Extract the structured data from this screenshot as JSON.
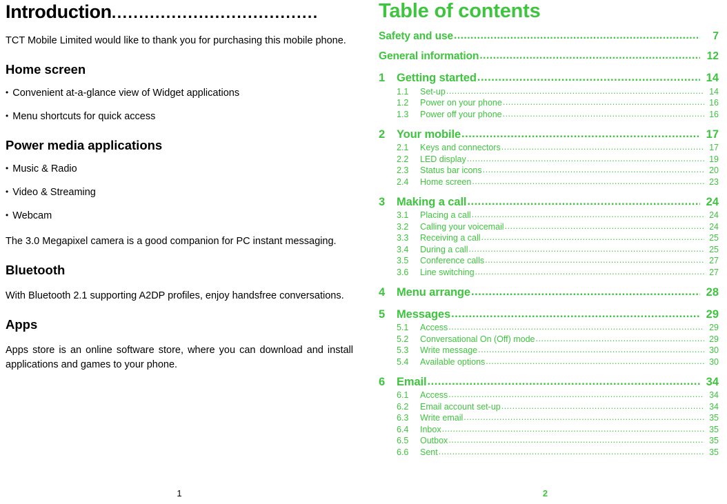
{
  "left": {
    "title": "Introduction",
    "title_dots": "......................................",
    "intro_paragraph": "TCT Mobile Limited would like to thank you for purchasing this mobile phone.",
    "sections": [
      {
        "heading": "Home screen",
        "bullets": [
          "Convenient at-a-glance view of Widget applications",
          "Menu shortcuts for quick access"
        ],
        "paragraphs": []
      },
      {
        "heading": "Power media applications",
        "bullets": [
          "Music & Radio",
          "Video & Streaming",
          "Webcam"
        ],
        "paragraphs": [
          "The 3.0 Megapixel camera is a good companion for PC instant messaging."
        ]
      },
      {
        "heading": "Bluetooth",
        "bullets": [],
        "paragraphs": [
          "With Bluetooth 2.1 supporting A2DP profiles, enjoy handsfree conversations."
        ]
      },
      {
        "heading": "Apps",
        "bullets": [],
        "paragraphs": [
          "Apps store is an online software store, where you can download and install applications and games to your phone."
        ]
      }
    ],
    "folio": "1"
  },
  "right": {
    "title": "Table of contents",
    "folio": "2",
    "entries": [
      {
        "level": 0,
        "num": "",
        "label": "Safety and use",
        "page": "7"
      },
      {
        "level": 0,
        "num": "",
        "label": "General information",
        "page": "12"
      },
      {
        "level": 1,
        "num": "1",
        "label": "Getting started",
        "page": "14"
      },
      {
        "level": 2,
        "num": "1.1",
        "label": "Set-up",
        "page": "14"
      },
      {
        "level": 2,
        "num": "1.2",
        "label": "Power on your phone",
        "page": "16"
      },
      {
        "level": 2,
        "num": "1.3",
        "label": "Power off your phone",
        "page": "16"
      },
      {
        "level": 1,
        "num": "2",
        "label": "Your mobile",
        "page": "17"
      },
      {
        "level": 2,
        "num": "2.1",
        "label": "Keys and connectors",
        "page": "17"
      },
      {
        "level": 2,
        "num": "2.2",
        "label": "LED display",
        "page": "19"
      },
      {
        "level": 2,
        "num": "2.3",
        "label": "Status bar icons",
        "page": "20"
      },
      {
        "level": 2,
        "num": "2.4",
        "label": "Home screen",
        "page": "23"
      },
      {
        "level": 1,
        "num": "3",
        "label": "Making a call",
        "page": "24"
      },
      {
        "level": 2,
        "num": "3.1",
        "label": "Placing a call",
        "page": "24"
      },
      {
        "level": 2,
        "num": "3.2",
        "label": "Calling your voicemail",
        "page": "24"
      },
      {
        "level": 2,
        "num": "3.3",
        "label": "Receiving a call",
        "page": "25"
      },
      {
        "level": 2,
        "num": "3.4",
        "label": "During a call",
        "page": "25"
      },
      {
        "level": 2,
        "num": "3.5",
        "label": "Conference calls",
        "page": "27"
      },
      {
        "level": 2,
        "num": "3.6",
        "label": "Line switching",
        "page": "27"
      },
      {
        "level": 1,
        "num": "4",
        "label": "Menu arrange",
        "page": "28"
      },
      {
        "level": 1,
        "num": "5",
        "label": "Messages",
        "page": "29"
      },
      {
        "level": 2,
        "num": "5.1",
        "label": "Access",
        "page": "29"
      },
      {
        "level": 2,
        "num": "5.2",
        "label": "Conversational On (Off) mode",
        "page": "29"
      },
      {
        "level": 2,
        "num": "5.3",
        "label": "Write message",
        "page": "30"
      },
      {
        "level": 2,
        "num": "5.4",
        "label": "Available options",
        "page": "30"
      },
      {
        "level": 1,
        "num": "6",
        "label": "Email",
        "page": "34"
      },
      {
        "level": 2,
        "num": "6.1",
        "label": "Access",
        "page": "34"
      },
      {
        "level": 2,
        "num": "6.2",
        "label": "Email account set-up",
        "page": "34"
      },
      {
        "level": 2,
        "num": "6.3",
        "label": "Write email",
        "page": "35"
      },
      {
        "level": 2,
        "num": "6.4",
        "label": "Inbox",
        "page": "35"
      },
      {
        "level": 2,
        "num": "6.5",
        "label": "Outbox",
        "page": "35"
      },
      {
        "level": 2,
        "num": "6.6",
        "label": "Sent",
        "page": "35"
      }
    ]
  },
  "colors": {
    "toc_green": "#3ec43e",
    "body_black": "#000000"
  }
}
